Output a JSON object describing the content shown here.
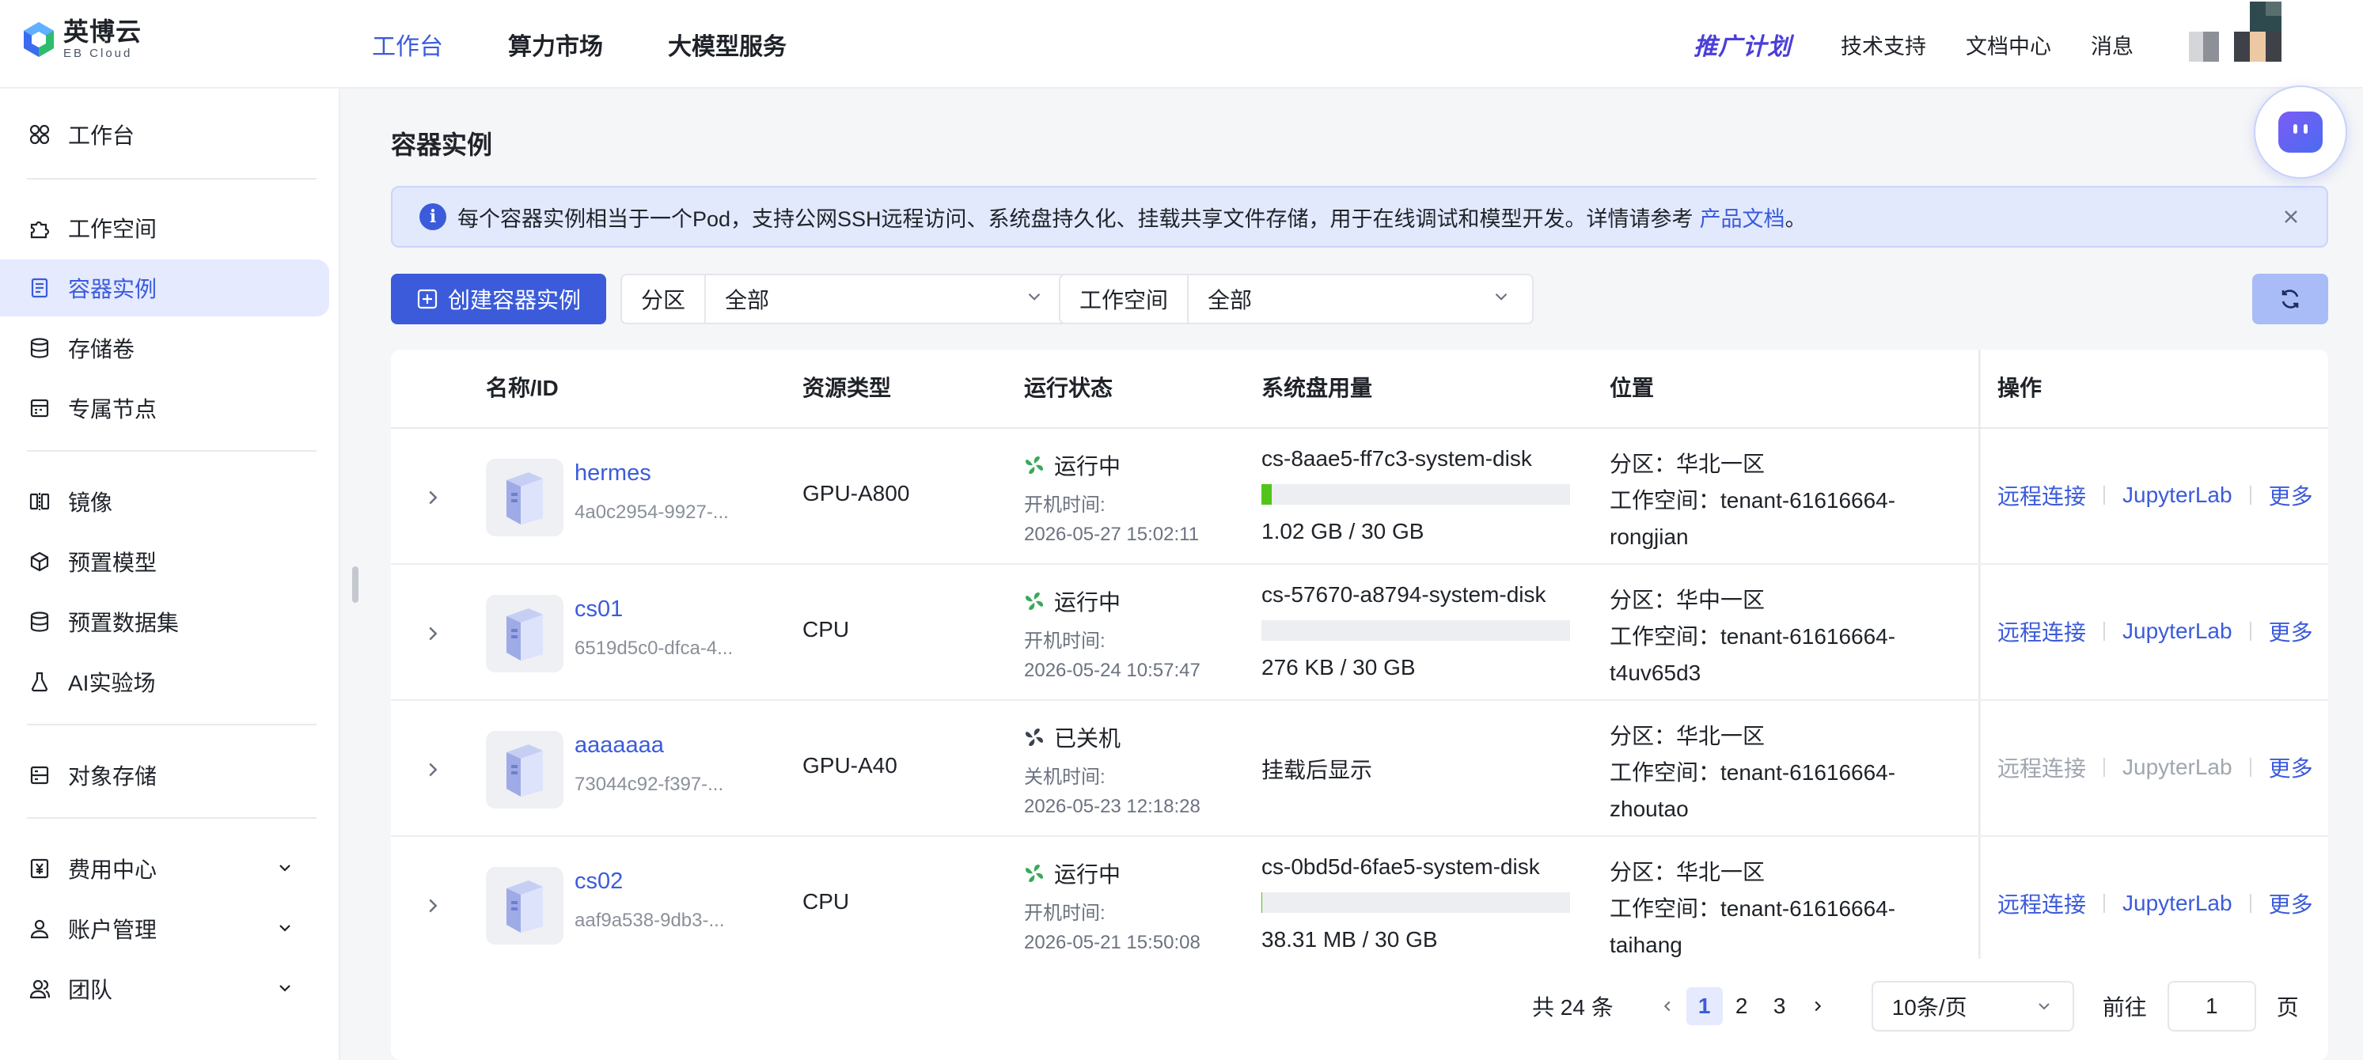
{
  "brand": {
    "name_cn": "英博云",
    "name_en": "EB Cloud",
    "accent": "#3b5bdb"
  },
  "topnav": {
    "items": [
      {
        "label": "工作台",
        "active": true
      },
      {
        "label": "算力市场",
        "active": false
      },
      {
        "label": "大模型服务",
        "active": false
      }
    ],
    "promo": "推广计划",
    "right": [
      "技术支持",
      "文档中心",
      "消息"
    ]
  },
  "sidebar": {
    "items": [
      {
        "label": "工作台",
        "icon": "dashboard-icon"
      },
      {
        "label": "工作空间",
        "icon": "puzzle-icon"
      },
      {
        "label": "容器实例",
        "icon": "container-icon",
        "active": true
      },
      {
        "label": "存储卷",
        "icon": "database-icon"
      },
      {
        "label": "专属节点",
        "icon": "server-icon"
      },
      {
        "label": "镜像",
        "icon": "mirror-icon"
      },
      {
        "label": "预置模型",
        "icon": "cube-icon"
      },
      {
        "label": "预置数据集",
        "icon": "database-icon"
      },
      {
        "label": "AI实验场",
        "icon": "flask-icon"
      },
      {
        "label": "对象存储",
        "icon": "storage-icon"
      },
      {
        "label": "费用中心",
        "icon": "yen-icon",
        "expandable": true
      },
      {
        "label": "账户管理",
        "icon": "user-icon",
        "expandable": true
      },
      {
        "label": "团队",
        "icon": "team-icon",
        "expandable": true
      }
    ]
  },
  "page": {
    "title": "容器实例",
    "notice": {
      "text": "每个容器实例相当于一个Pod，支持公网SSH远程访问、系统盘持久化、挂载共享文件存储，用于在线调试和模型开发。详情请参考",
      "link": "产品文档",
      "suffix": "。"
    },
    "create_label": "创建容器实例",
    "filters": [
      {
        "label": "分区",
        "value": "全部"
      },
      {
        "label": "工作空间",
        "value": "全部"
      }
    ]
  },
  "table": {
    "columns": [
      "名称/ID",
      "资源类型",
      "运行状态",
      "系统盘用量",
      "位置",
      "操作"
    ],
    "rows": [
      {
        "name": "hermes",
        "id": "4a0c2954-9927-...",
        "type": "GPU-A800",
        "status": "运行中",
        "running": true,
        "time_label": "开机时间:",
        "time": "2026-05-27 15:02:11",
        "disk": "cs-8aae5-ff7c3-system-disk",
        "disk_usage": 0.034,
        "disk_size": "1.02 GB / 30 GB",
        "zone": "分区：华北一区",
        "ws1": "工作空间：tenant-61616664-",
        "ws2": "rongjian",
        "ops": [
          "远程连接",
          "JupyterLab",
          "更多"
        ]
      },
      {
        "name": "cs01",
        "id": "6519d5c0-dfca-4...",
        "type": "CPU",
        "status": "运行中",
        "running": true,
        "time_label": "开机时间:",
        "time": "2026-05-24 10:57:47",
        "disk": "cs-57670-a8794-system-disk",
        "disk_usage": 0.0,
        "disk_size": "276 KB / 30 GB",
        "zone": "分区：华中一区",
        "ws1": "工作空间：tenant-61616664-",
        "ws2": "t4uv65d3",
        "ops": [
          "远程连接",
          "JupyterLab",
          "更多"
        ]
      },
      {
        "name": "aaaaaaa",
        "id": "73044c92-f397-...",
        "type": "GPU-A40",
        "status": "已关机",
        "running": false,
        "time_label": "关机时间:",
        "time": "2026-05-23 12:18:28",
        "disk_empty": "挂载后显示",
        "zone": "分区：华北一区",
        "ws1": "工作空间：tenant-61616664-",
        "ws2": "zhoutao",
        "ops": [
          "远程连接",
          "JupyterLab",
          "更多"
        ]
      },
      {
        "name": "cs02",
        "id": "aaf9a538-9db3-...",
        "type": "CPU",
        "status": "运行中",
        "running": true,
        "time_label": "开机时间:",
        "time": "2026-05-21 15:50:08",
        "disk": "cs-0bd5d-6fae5-system-disk",
        "disk_usage": 0.001,
        "disk_size": "38.31 MB / 30 GB",
        "zone": "分区：华北一区",
        "ws1": "工作空间：tenant-61616664-",
        "ws2": "taihang",
        "ops": [
          "远程连接",
          "JupyterLab",
          "更多"
        ]
      }
    ]
  },
  "pagination": {
    "total": "共 24 条",
    "pages": [
      "1",
      "2",
      "3"
    ],
    "current": "1",
    "page_size": "10条/页",
    "goto_label": "前往",
    "goto_value": "1",
    "page_unit": "页"
  }
}
